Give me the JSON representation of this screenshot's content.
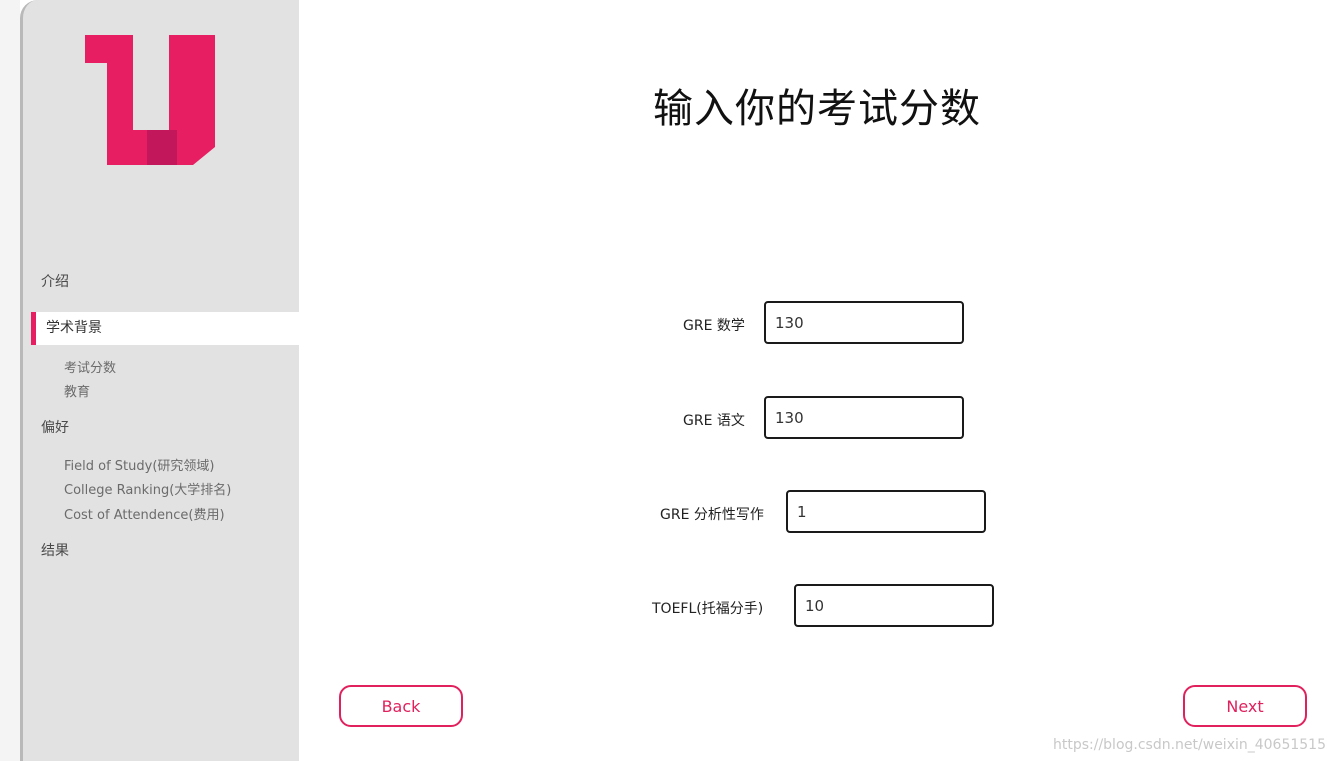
{
  "sidebar": {
    "logo": "u-logo",
    "nav": {
      "intro": "介绍",
      "academic": "学术背景",
      "academic_sub": [
        "考试分数",
        "教育"
      ],
      "preferences": "偏好",
      "preferences_sub": [
        "Field of Study(研究领域)",
        "College Ranking(大学排名)",
        "Cost of Attendence(费用)"
      ],
      "results": "结果"
    }
  },
  "main": {
    "title": "输入你的考试分数",
    "fields": [
      {
        "label": "GRE 数学",
        "value": "130"
      },
      {
        "label": "GRE 语文",
        "value": "130"
      },
      {
        "label": "GRE 分析性写作",
        "value": "1"
      },
      {
        "label": "TOEFL(托福分手)",
        "value": "10"
      }
    ],
    "back_label": "Back",
    "next_label": "Next"
  },
  "watermark": "https://blog.csdn.net/weixin_40651515",
  "colors": {
    "accent": "#e81e63",
    "logo_dark": "#c2185b",
    "sidebar_bg": "#e2e2e2"
  }
}
